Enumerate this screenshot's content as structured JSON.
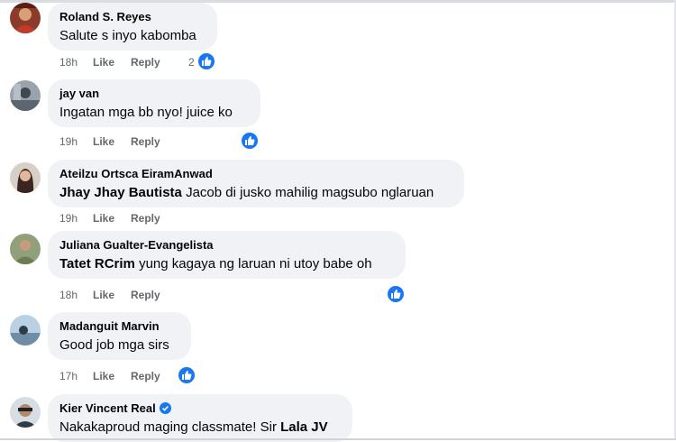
{
  "comments": [
    {
      "author": "Roland S. Reyes",
      "mention": "",
      "text": "Salute s inyo kabomba",
      "time": "18h",
      "reaction_count": "2",
      "avatar_icon": "avatar-photo-icon",
      "verified": false
    },
    {
      "author": "jay van",
      "mention": "",
      "text": "Ingatan mga bb nyo! juice ko",
      "time": "19h",
      "reaction_count": "",
      "avatar_icon": "avatar-photo-icon",
      "verified": false
    },
    {
      "author": "Ateilzu Ortsca EiramAnwad",
      "mention": "Jhay Jhay Bautista",
      "text": " Jacob di jusko mahilig magsubo nglaruan",
      "time": "19h",
      "reaction_count": "",
      "avatar_icon": "avatar-photo-icon",
      "verified": false
    },
    {
      "author": "Juliana Gualter-Evangelista",
      "mention": "Tatet RCrim",
      "text": " yung kagaya ng laruan ni utoy babe oh",
      "time": "18h",
      "reaction_count": "",
      "avatar_icon": "avatar-photo-icon",
      "verified": false
    },
    {
      "author": "Madanguit Marvin",
      "mention": "",
      "text": "Good job mga sirs",
      "time": "17h",
      "reaction_count": "",
      "avatar_icon": "avatar-photo-icon",
      "verified": false
    },
    {
      "author": "Kier Vincent Real",
      "mention": "",
      "text": "Nakakaproud maging classmate! Sir ",
      "mention_end": "Lala JV",
      "time": "",
      "reaction_count": "",
      "avatar_icon": "avatar-photo-icon",
      "verified": true
    }
  ],
  "actions": {
    "like_label": "Like",
    "reply_label": "Reply"
  },
  "colors": {
    "bubble_bg": "#f0f2f5",
    "meta_text": "#65676b",
    "like_blue": "#1877f2",
    "text": "#050505"
  },
  "icons": {
    "reaction": "like-thumb-icon",
    "verified": "verified-badge-icon"
  }
}
